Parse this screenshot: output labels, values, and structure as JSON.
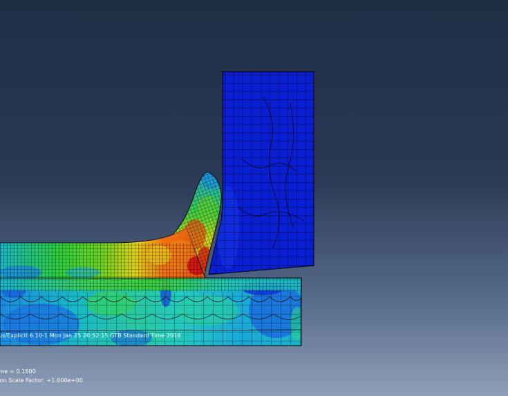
{
  "stamp": {
    "text": "us/Explicit 6.10-1    Mon Jan 25 20:52:15 GTB Standard Time 2016"
  },
  "status": {
    "step_time": "ime =   0.1600",
    "deformation_scale": "tion Scale Factor: +1.000e+00"
  },
  "colors": {
    "background_top": "#1f2d45",
    "background_bottom": "#8e9fb8",
    "mesh_line": "#000000",
    "contour_blue": "#0a1fd4",
    "contour_mid_blue": "#1560e0",
    "contour_cyan": "#12c8c0",
    "contour_green": "#2ccf2c",
    "contour_yellow": "#d8e020",
    "contour_orange": "#f07010",
    "contour_red": "#d41010"
  },
  "parts": {
    "tool": "cutting-tool",
    "workpiece": "workpiece",
    "chip": "chip"
  }
}
